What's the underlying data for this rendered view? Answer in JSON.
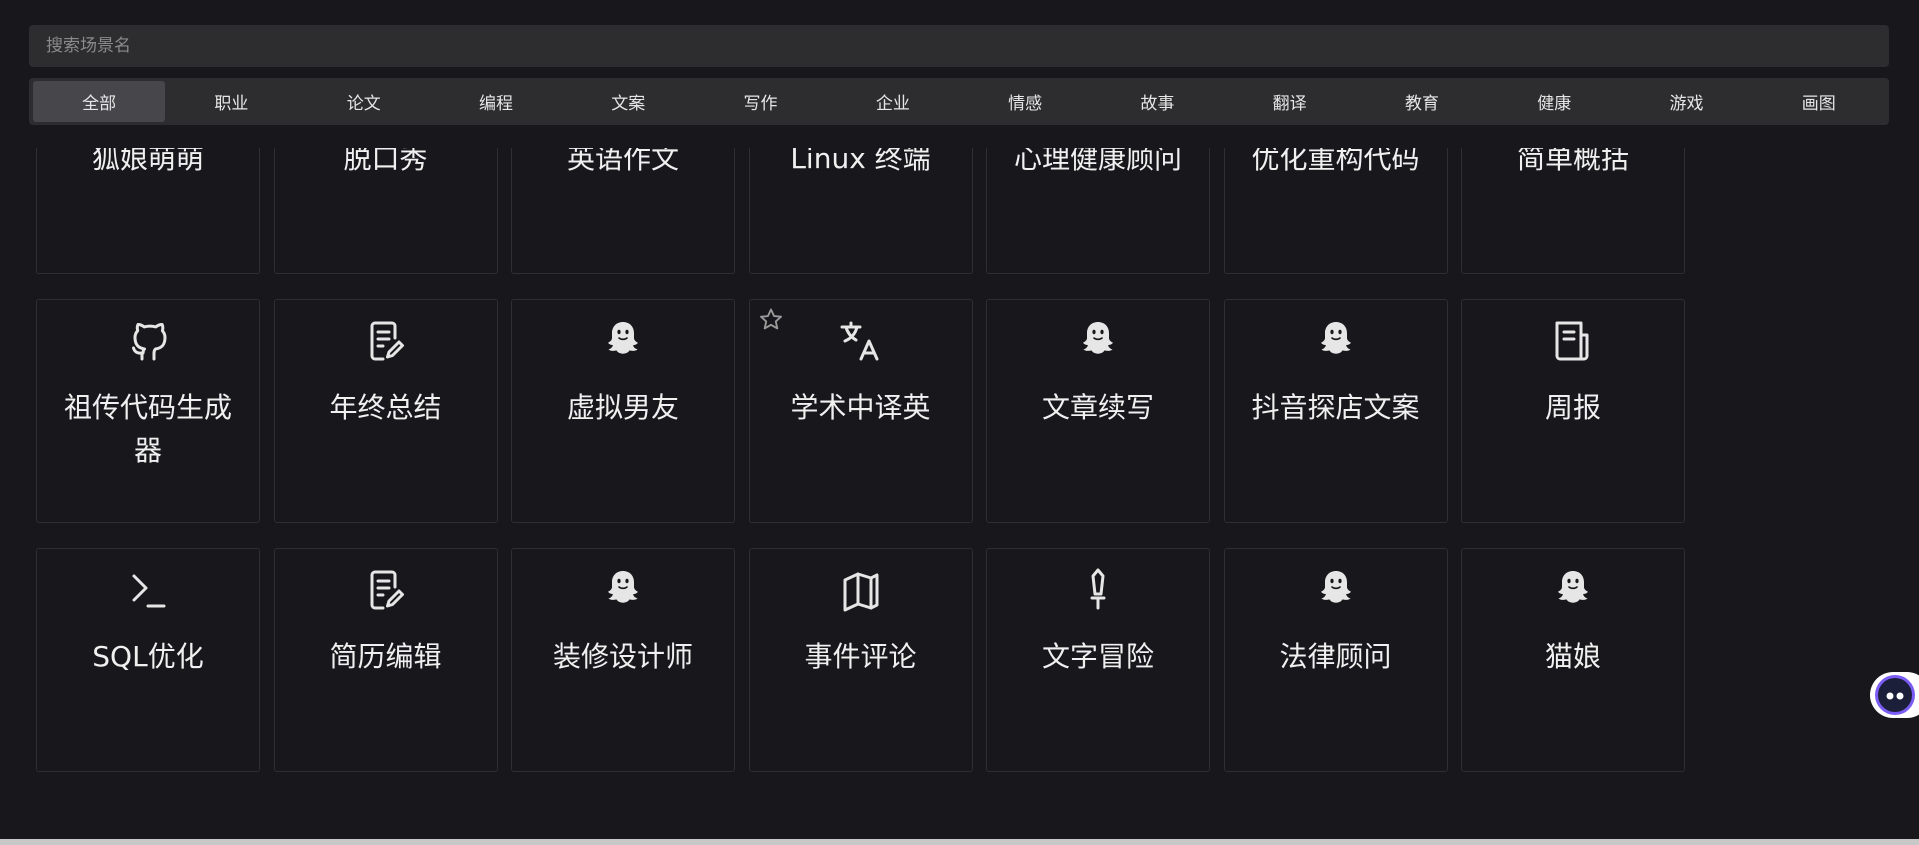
{
  "search": {
    "placeholder": "搜索场景名",
    "value": ""
  },
  "tabs": [
    {
      "label": "全部",
      "active": true
    },
    {
      "label": "职业"
    },
    {
      "label": "论文"
    },
    {
      "label": "编程"
    },
    {
      "label": "文案"
    },
    {
      "label": "写作"
    },
    {
      "label": "企业"
    },
    {
      "label": "情感"
    },
    {
      "label": "故事"
    },
    {
      "label": "翻译"
    },
    {
      "label": "教育"
    },
    {
      "label": "健康"
    },
    {
      "label": "游戏"
    },
    {
      "label": "画图"
    }
  ],
  "cards": [
    {
      "title": "狐娘萌萌",
      "icon": "cat-icon"
    },
    {
      "title": "脱口秀",
      "icon": "ghost-icon"
    },
    {
      "title": "英语作文",
      "icon": "edit-doc-icon"
    },
    {
      "title": "Linux 终端",
      "icon": "terminal-box-icon"
    },
    {
      "title": "心理健康顾问",
      "icon": "ghost-icon"
    },
    {
      "title": "优化重构代码",
      "icon": "github-icon"
    },
    {
      "title": "简单概括",
      "icon": "ghost-icon"
    },
    {
      "title": "祖传代码生成器",
      "icon": "github-icon"
    },
    {
      "title": "年终总结",
      "icon": "edit-doc-icon"
    },
    {
      "title": "虚拟男友",
      "icon": "ghost-icon"
    },
    {
      "title": "学术中译英",
      "icon": "translate-icon",
      "star": true
    },
    {
      "title": "文章续写",
      "icon": "ghost-icon"
    },
    {
      "title": "抖音探店文案",
      "icon": "ghost-icon"
    },
    {
      "title": "周报",
      "icon": "report-icon"
    },
    {
      "title": "SQL优化",
      "icon": "terminal-prompt-icon"
    },
    {
      "title": "简历编辑",
      "icon": "edit-doc-icon"
    },
    {
      "title": "装修设计师",
      "icon": "ghost-icon"
    },
    {
      "title": "事件评论",
      "icon": "book-open-icon"
    },
    {
      "title": "文字冒险",
      "icon": "sword-icon"
    },
    {
      "title": "法律顾问",
      "icon": "ghost-icon"
    },
    {
      "title": "猫娘",
      "icon": "ghost-icon"
    }
  ],
  "colors": {
    "background": "#18181c",
    "panel": "#2d2d30",
    "active_tab": "#47474b",
    "text": "#e6e6e6"
  }
}
